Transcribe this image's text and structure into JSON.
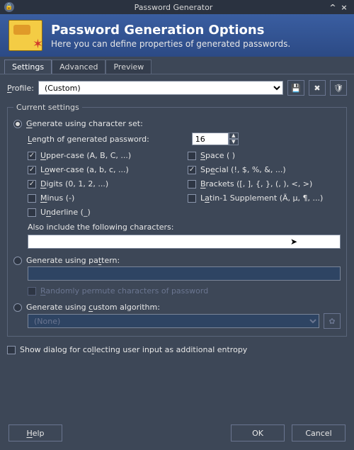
{
  "window": {
    "title": "Password Generator",
    "minimize": "^",
    "close": "×"
  },
  "header": {
    "title": "Password Generation Options",
    "subtitle": "Here you can define properties of generated passwords."
  },
  "tabs": {
    "settings": "Settings",
    "advanced": "Advanced",
    "preview": "Preview",
    "active": "settings"
  },
  "profile": {
    "label": "Profile:",
    "value": "(Custom)"
  },
  "group_legend": "Current settings",
  "modes": {
    "charset": {
      "label": "Generate using character set:",
      "selected": true,
      "length_label": "Length of generated password:",
      "length_value": "16",
      "options": {
        "upper": {
          "label": "Upper-case (A, B, C, ...)",
          "checked": true
        },
        "space": {
          "label": "Space ( )",
          "checked": false
        },
        "lower": {
          "label": "Lower-case (a, b, c, ...)",
          "checked": true
        },
        "special": {
          "label": "Special (!, $, %, &, ...)",
          "checked": true
        },
        "digits": {
          "label": "Digits (0, 1, 2, ...)",
          "checked": true
        },
        "brackets": {
          "label": "Brackets ([, ], {, }, (, ), <, >)",
          "checked": false
        },
        "minus": {
          "label": "Minus (-)",
          "checked": false
        },
        "latin1": {
          "label": "Latin-1 Supplement (Ä, µ, ¶, ...)",
          "checked": false
        },
        "underline": {
          "label": "Underline (_)",
          "checked": false
        }
      },
      "also_label": "Also include the following characters:",
      "also_value": ""
    },
    "pattern": {
      "label": "Generate using pattern:",
      "selected": false,
      "value": "",
      "permute": {
        "label": "Randomly permute characters of password",
        "checked": false
      }
    },
    "algorithm": {
      "label": "Generate using custom algorithm:",
      "selected": false,
      "value": "(None)"
    }
  },
  "entropy": {
    "label": "Show dialog for collecting user input as additional entropy",
    "checked": false
  },
  "buttons": {
    "help": "Help",
    "ok": "OK",
    "cancel": "Cancel"
  },
  "icons": {
    "save_profile": "💾",
    "delete_profile": "✖",
    "policy": "🛡",
    "algo_settings": "✿"
  }
}
